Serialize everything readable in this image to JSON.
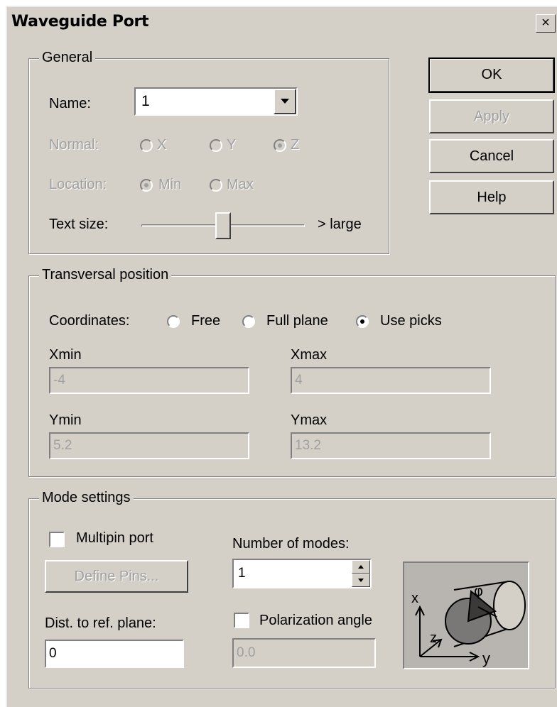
{
  "dialog": {
    "title": "Waveguide Port",
    "close_glyph": "×"
  },
  "buttons": {
    "ok": "OK",
    "apply": "Apply",
    "cancel": "Cancel",
    "help": "Help"
  },
  "general": {
    "legend": "General",
    "name_label": "Name:",
    "name_value": "1",
    "normal_label": "Normal:",
    "normal_options": [
      "X",
      "Y",
      "Z"
    ],
    "normal_selected": "Z",
    "location_label": "Location:",
    "location_options": [
      "Min",
      "Max"
    ],
    "location_selected": "Min",
    "textsize_label": "Text size:",
    "textsize_max_label": "> large",
    "textsize_level": 0.5
  },
  "transversal": {
    "legend": "Transversal position",
    "coords_label": "Coordinates:",
    "coord_options": [
      "Free",
      "Full plane",
      "Use picks"
    ],
    "coord_selected": "Use picks",
    "xmin_label": "Xmin",
    "xmin_value": "-4",
    "xmax_label": "Xmax",
    "xmax_value": "4",
    "ymin_label": "Ymin",
    "ymin_value": "5.2",
    "ymax_label": "Ymax",
    "ymax_value": "13.2"
  },
  "mode": {
    "legend": "Mode settings",
    "multipin_label": "Multipin port",
    "multipin_checked": false,
    "define_pins": "Define Pins...",
    "num_modes_label": "Number of modes:",
    "num_modes_value": "1",
    "dist_label": "Dist. to ref. plane:",
    "dist_value": "0",
    "polarization_label": "Polarization angle",
    "polarization_checked": false,
    "polarization_value": "0.0",
    "diagram": {
      "x": "x",
      "y": "y",
      "z": "z",
      "phi": "φ"
    }
  }
}
